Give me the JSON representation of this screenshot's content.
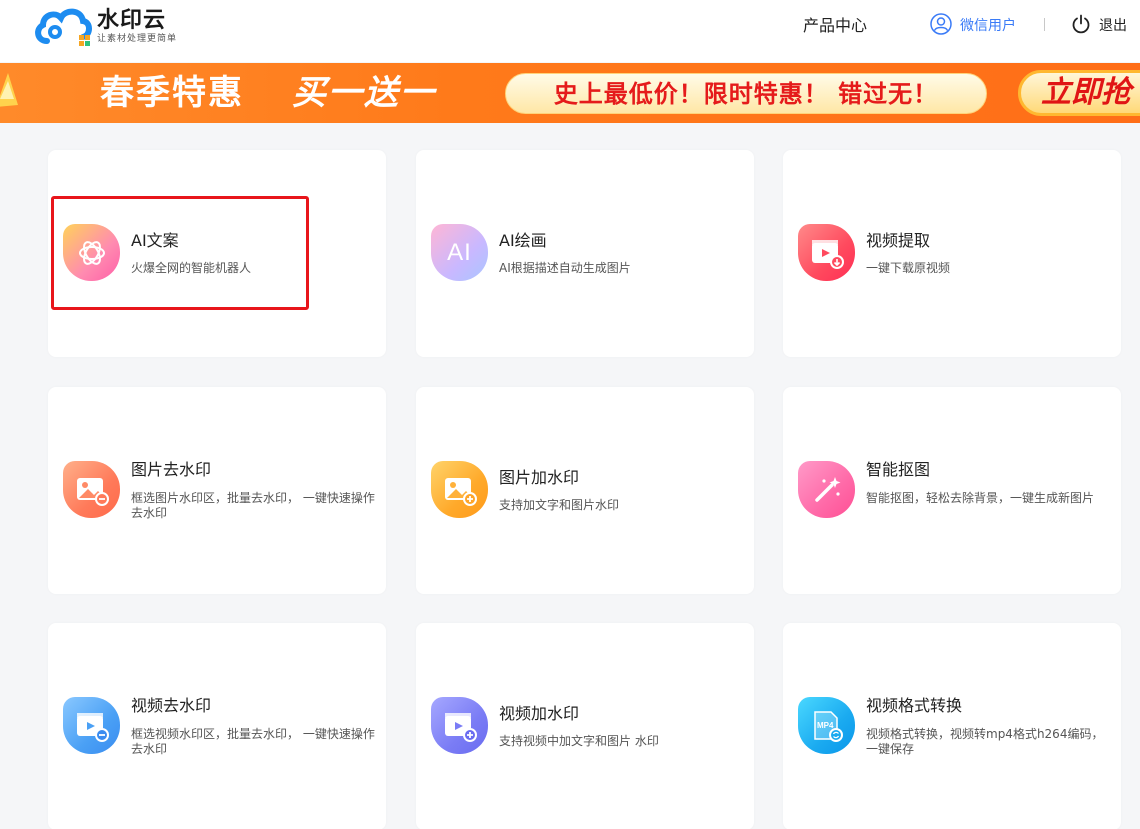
{
  "header": {
    "logo_title": "水印云",
    "logo_subtitle": "让素材处理更简单",
    "product_center": "产品中心",
    "user_name": "微信用户",
    "logout": "退出"
  },
  "banner": {
    "text1": "春季特惠",
    "text2": "买一送一",
    "pill_text": "史上最低价！限时特惠！ 错过无！",
    "button_text": "立即抢"
  },
  "cards": [
    {
      "title": "AI文案",
      "desc": "火爆全网的智能机器人",
      "icon": "openai-icon"
    },
    {
      "title": "AI绘画",
      "desc": "AI根据描述自动生成图片",
      "icon": "ai-text-icon",
      "icon_text": "AI"
    },
    {
      "title": "视频提取",
      "desc": "一键下载原视频",
      "icon": "video-download-icon"
    },
    {
      "title": "图片去水印",
      "desc": "框选图片水印区，批量去水印， 一键快速操作去水印",
      "icon": "image-remove-icon"
    },
    {
      "title": "图片加水印",
      "desc": "支持加文字和图片水印",
      "icon": "image-add-icon"
    },
    {
      "title": "智能抠图",
      "desc": "智能抠图，轻松去除背景，一键生成新图片",
      "icon": "magic-wand-icon"
    },
    {
      "title": "视频去水印",
      "desc": "框选视频水印区，批量去水印， 一键快速操作去水印",
      "icon": "video-remove-icon"
    },
    {
      "title": "视频加水印",
      "desc": "支持视频中加文字和图片 水印",
      "icon": "video-add-icon"
    },
    {
      "title": "视频格式转换",
      "desc": "视频格式转换，视频转mp4格式h264编码，一键保存",
      "icon": "mp4-icon",
      "icon_text": "MP4"
    }
  ]
}
